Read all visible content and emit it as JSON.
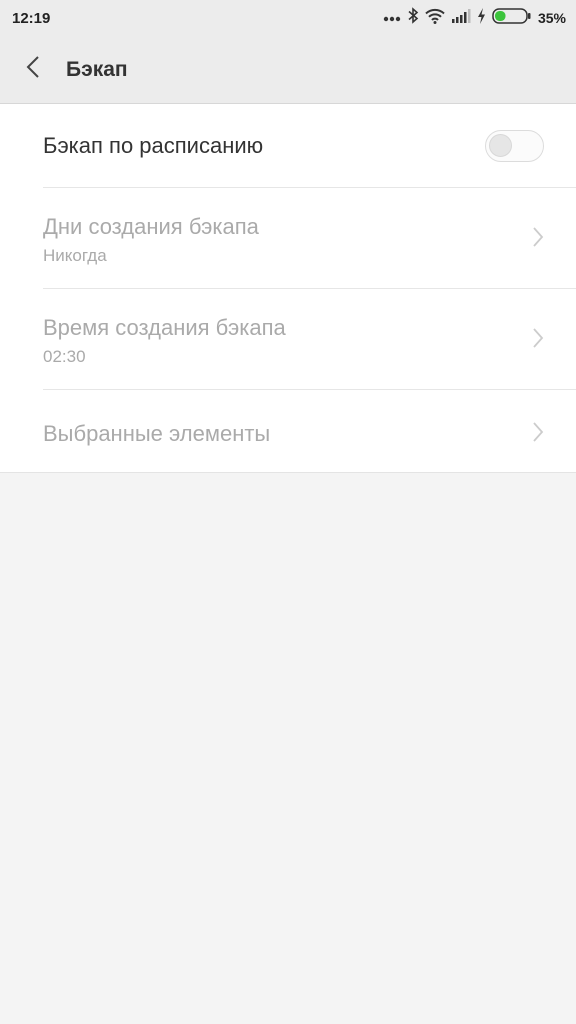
{
  "status_bar": {
    "time": "12:19",
    "icons": [
      "more-dots-icon",
      "bluetooth-icon",
      "wifi-icon",
      "signal-icon",
      "charging-icon",
      "battery-icon"
    ],
    "battery_percent": "35%",
    "battery_level": 0.35,
    "battery_color": "#3cc43c"
  },
  "header": {
    "back_icon": "chevron-left-icon",
    "title": "Бэкап"
  },
  "settings": {
    "schedule": {
      "label": "Бэкап по расписанию",
      "enabled": false
    },
    "days": {
      "label": "Дни создания бэкапа",
      "value": "Никогда"
    },
    "time": {
      "label": "Время создания бэкапа",
      "value": "02:30"
    },
    "items": {
      "label": "Выбранные элементы"
    }
  }
}
